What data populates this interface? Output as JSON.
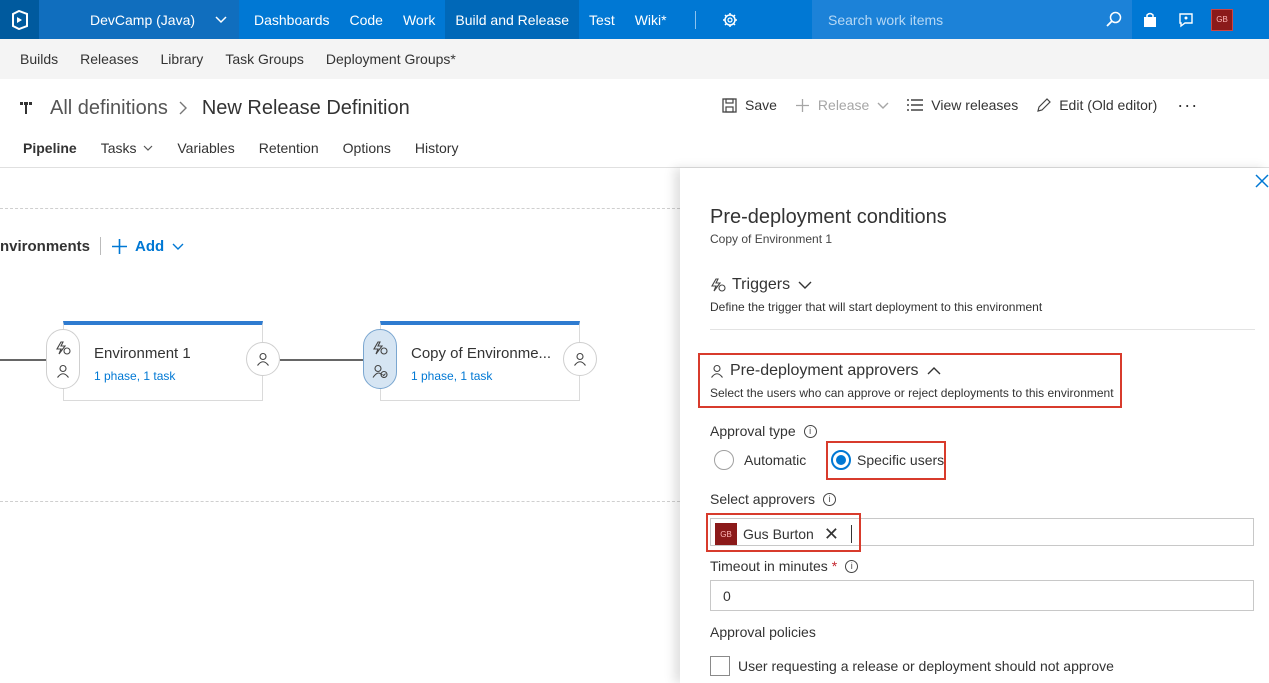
{
  "colors": {
    "accent": "#0078d4",
    "topbar": "#0078d4",
    "highlight": "#d83b2c",
    "avatar": "#8b1a1a"
  },
  "topbar": {
    "project": "DevCamp (Java)",
    "nav": [
      "Dashboards",
      "Code",
      "Work",
      "Build and Release",
      "Test",
      "Wiki*"
    ],
    "active_nav": "Build and Release",
    "search_placeholder": "Search work items",
    "user_initials": "GB"
  },
  "hub": {
    "items": [
      "Builds",
      "Releases",
      "Library",
      "Task Groups",
      "Deployment Groups*"
    ]
  },
  "header": {
    "breadcrumb_root": "All definitions",
    "title": "New Release Definition",
    "actions": {
      "save": "Save",
      "release": "Release",
      "view_releases": "View releases",
      "edit_old": "Edit (Old editor)",
      "more": "···"
    }
  },
  "tabs": [
    "Pipeline",
    "Tasks",
    "Variables",
    "Retention",
    "Options",
    "History"
  ],
  "pipeline": {
    "environments_label": "nvironments",
    "add_label": "Add",
    "cards": [
      {
        "name": "Environment 1",
        "sub": "1 phase, 1 task"
      },
      {
        "name": "Copy of Environme...",
        "sub": "1 phase, 1 task"
      }
    ]
  },
  "panel": {
    "title": "Pre-deployment conditions",
    "subtitle": "Copy of Environment 1",
    "triggers": {
      "label": "Triggers",
      "desc": "Define the trigger that will start deployment to this environment"
    },
    "approvers": {
      "label": "Pre-deployment approvers",
      "desc": "Select the users who can approve or reject deployments to this environment"
    },
    "approval_type": {
      "label": "Approval type",
      "options": [
        "Automatic",
        "Specific users"
      ],
      "selected": "Specific users"
    },
    "select_approvers": {
      "label": "Select approvers",
      "chip_name": "Gus Burton",
      "chip_initials": "GB"
    },
    "timeout": {
      "label": "Timeout in minutes",
      "required_mark": "*",
      "value": "0"
    },
    "policies": {
      "label": "Approval policies",
      "option": "User requesting a release or deployment should not approve"
    }
  }
}
